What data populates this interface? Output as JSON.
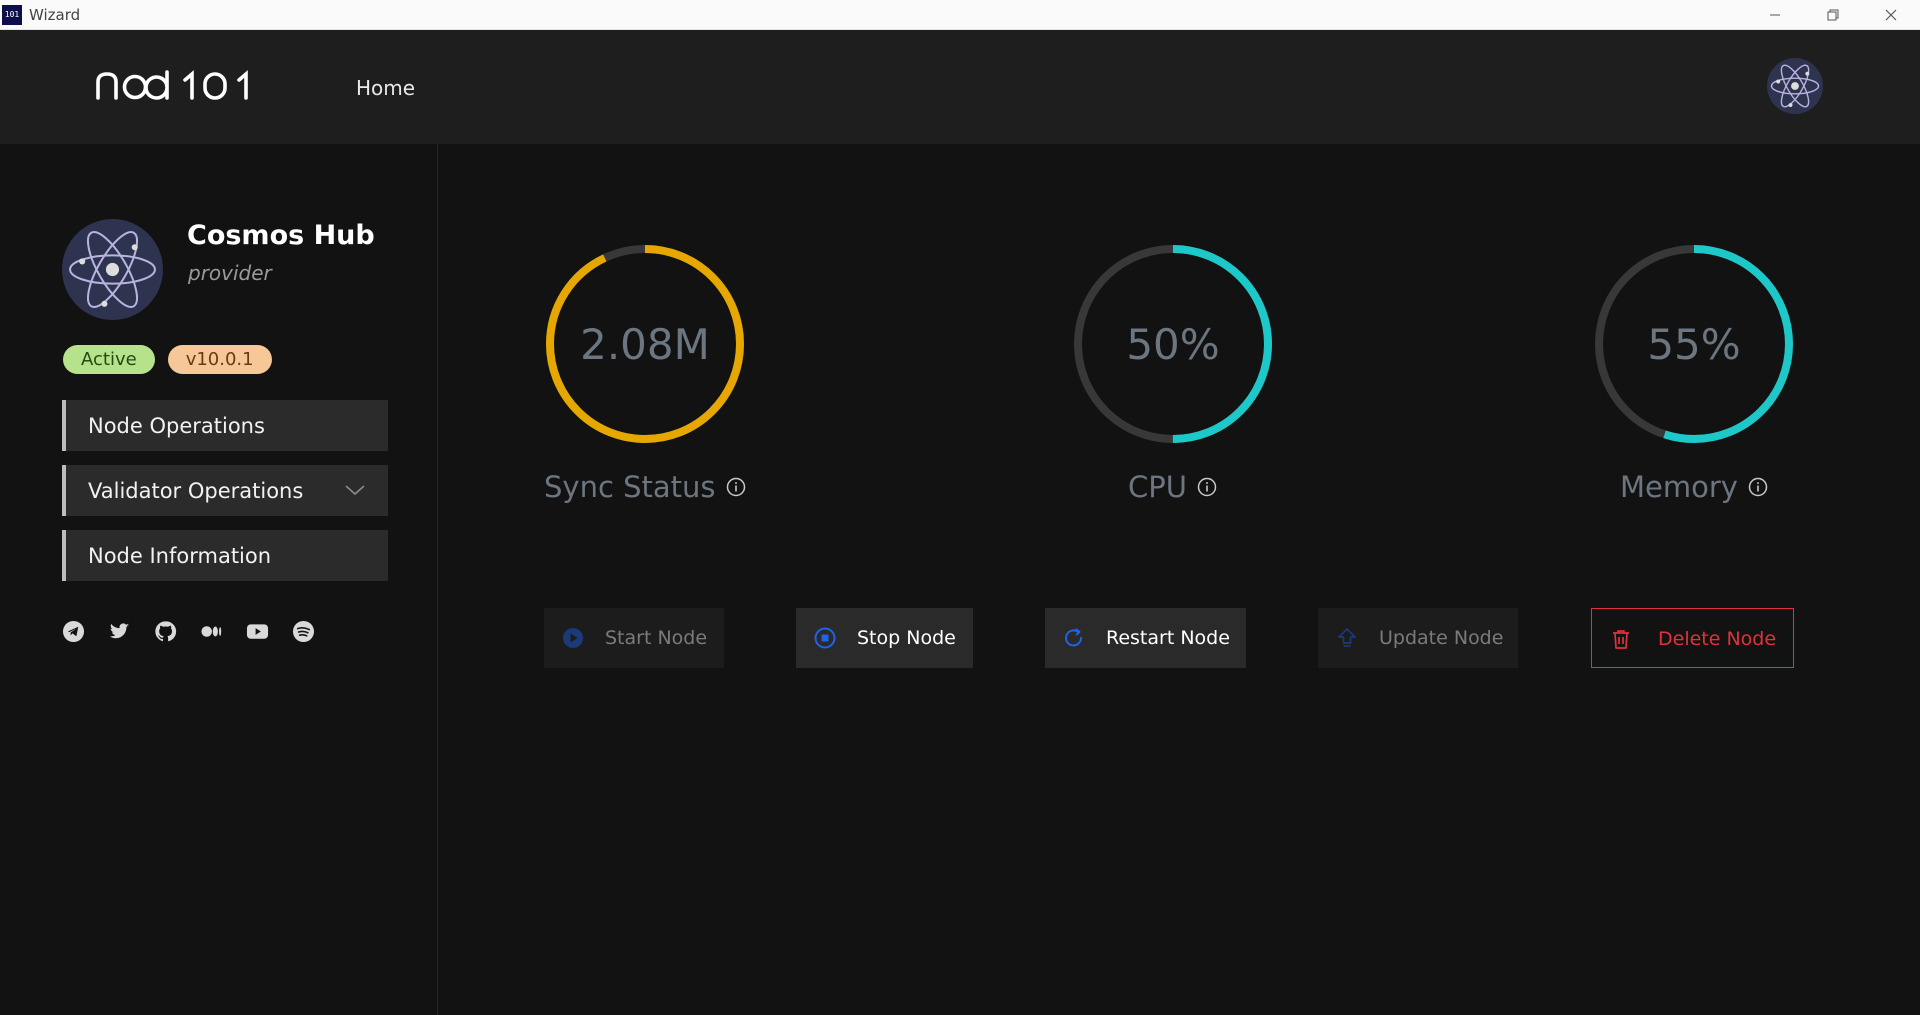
{
  "window": {
    "title": "Wizard",
    "app_icon_text": "101"
  },
  "header": {
    "logo_text": "node101",
    "nav_home": "Home"
  },
  "profile": {
    "name": "Cosmos Hub",
    "role": "provider",
    "status_badge": "Active",
    "version_badge": "v10.0.1"
  },
  "menu": {
    "items": [
      {
        "label": "Node Operations"
      },
      {
        "label": "Validator Operations"
      },
      {
        "label": "Node Information"
      }
    ]
  },
  "socials": [
    "telegram-icon",
    "twitter-icon",
    "github-icon",
    "medium-icon",
    "youtube-icon",
    "spotify-icon"
  ],
  "gauges": {
    "sync": {
      "value": "2.08M",
      "label": "Sync Status",
      "fraction": 0.93,
      "color": "#e5a700"
    },
    "cpu": {
      "value": "50%",
      "label": "CPU",
      "fraction": 0.5,
      "color": "#1ec8c8"
    },
    "memory": {
      "value": "55%",
      "label": "Memory",
      "fraction": 0.55,
      "color": "#1ec8c8"
    },
    "track_color": "#383838"
  },
  "actions": {
    "start": "Start Node",
    "stop": "Stop Node",
    "restart": "Restart Node",
    "update": "Update Node",
    "delete": "Delete Node"
  },
  "colors": {
    "accent_blue": "#1e63e8",
    "danger": "#e0313d"
  }
}
